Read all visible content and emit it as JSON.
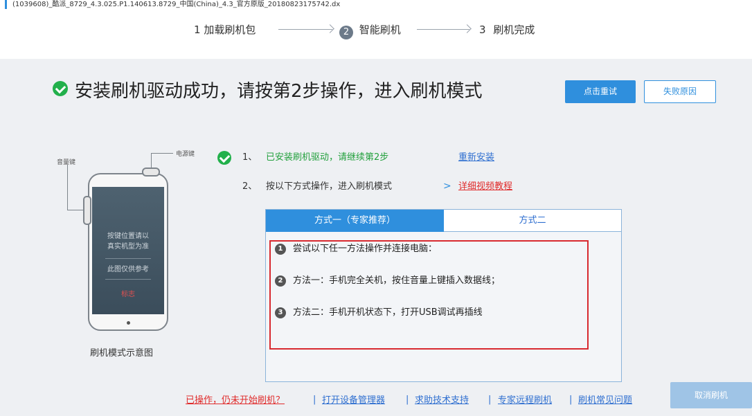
{
  "window": {
    "title": "(1039608)_酷派_8729_4.3.025.P1.140613.8729_中国(China)_4.3_官方原版_20180823175742.dx"
  },
  "steps": [
    {
      "number": "1",
      "label": "加载刷机包"
    },
    {
      "number": "2",
      "label": "智能刷机"
    },
    {
      "number": "3",
      "label": "刷机完成"
    }
  ],
  "headline": "安装刷机驱动成功，请按第2步操作，进入刷机模式",
  "buttons": {
    "retry": "点击重试",
    "failure_reason": "失败原因",
    "cancel_flash": "取消刷机"
  },
  "phone": {
    "volume_key_label": "音量键",
    "power_key_label": "电源键",
    "screen_line1": "按键位置请以",
    "screen_line2": "真实机型为准",
    "screen_note": "此图仅供参考",
    "screen_red": "标志",
    "caption": "刷机模式示意图"
  },
  "instructions": {
    "item1_number": "1、",
    "item1_text": "已安装刷机驱动，请继续第2步",
    "item1_link": "重新安装",
    "item2_number": "2、",
    "item2_text": "按以下方式操作，进入刷机模式",
    "item2_chevron": ">",
    "item2_link": "详细视频教程"
  },
  "tabs": [
    {
      "label": "方式一（专家推荐）",
      "active": true
    },
    {
      "label": "方式二",
      "active": false
    }
  ],
  "methods": [
    {
      "index": "1",
      "text": "尝试以下任一方法操作并连接电脑："
    },
    {
      "index": "2",
      "text": "方法一：手机完全关机，按住音量上键插入数据线；"
    },
    {
      "index": "3",
      "text": "方法二：手机开机状态下，打开USB调试再插线"
    }
  ],
  "footer_links": {
    "not_started": "已操作，仍未开始刷机？",
    "device_manager": "打开设备管理器",
    "tech_support": "求助技术支持",
    "remote_flash": "专家远程刷机",
    "faq": "刷机常见问题",
    "separator": "|"
  },
  "colors": {
    "accent": "#2f8fdd",
    "success": "#22b04b",
    "warning_link": "#e02b2b",
    "highlight_border": "#d8292f"
  }
}
